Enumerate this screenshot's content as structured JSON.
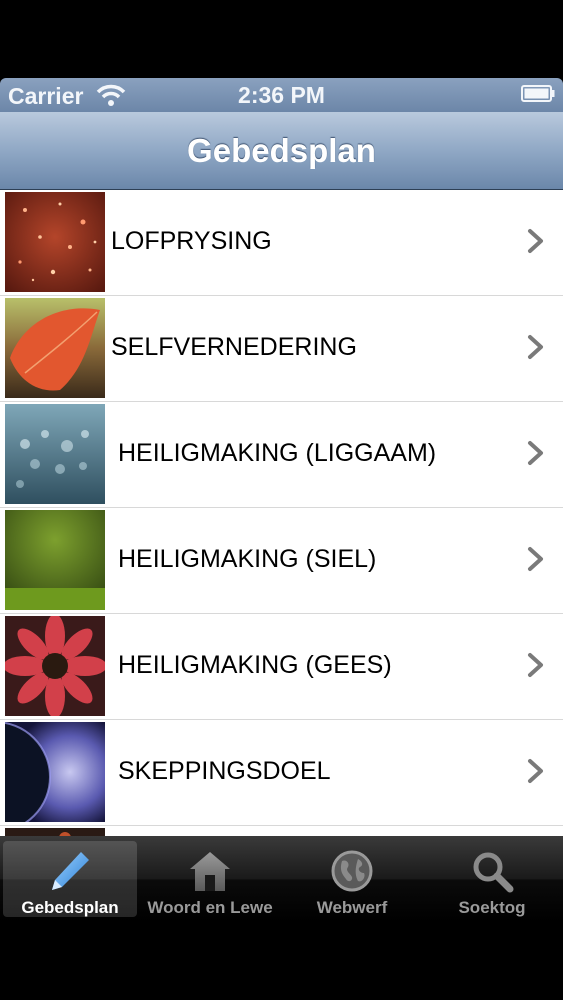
{
  "status_bar": {
    "carrier": "Carrier",
    "time": "2:36 PM"
  },
  "nav": {
    "title": "Gebedsplan"
  },
  "list": {
    "items": [
      {
        "label": "LOFPRYSING",
        "image": "sparkle-red-photo"
      },
      {
        "label": "SELFVERNEDERING",
        "image": "red-leaf-photo"
      },
      {
        "label": "HEILIGMAKING (LIGGAAM)",
        "image": "water-splash-photo"
      },
      {
        "label": "HEILIGMAKING (SIEL)",
        "image": "green-grass-photo"
      },
      {
        "label": "HEILIGMAKING (GEES)",
        "image": "red-flower-photo"
      },
      {
        "label": "SKEPPINGSDOEL",
        "image": "planet-glow-photo"
      }
    ]
  },
  "tab_bar": {
    "tabs": [
      {
        "label": "Gebedsplan",
        "icon": "pencil-icon",
        "selected": true
      },
      {
        "label": "Woord en Lewe",
        "icon": "house-icon",
        "selected": false
      },
      {
        "label": "Webwerf",
        "icon": "globe-icon",
        "selected": false
      },
      {
        "label": "Soektog",
        "icon": "magnifier-icon",
        "selected": false
      }
    ]
  },
  "colors": {
    "nav_top": "#b9c9dd",
    "nav_bottom": "#6b87aa",
    "tab_bar": "#1a1a1a",
    "selected_tab_icon": "#4fa3f0"
  }
}
